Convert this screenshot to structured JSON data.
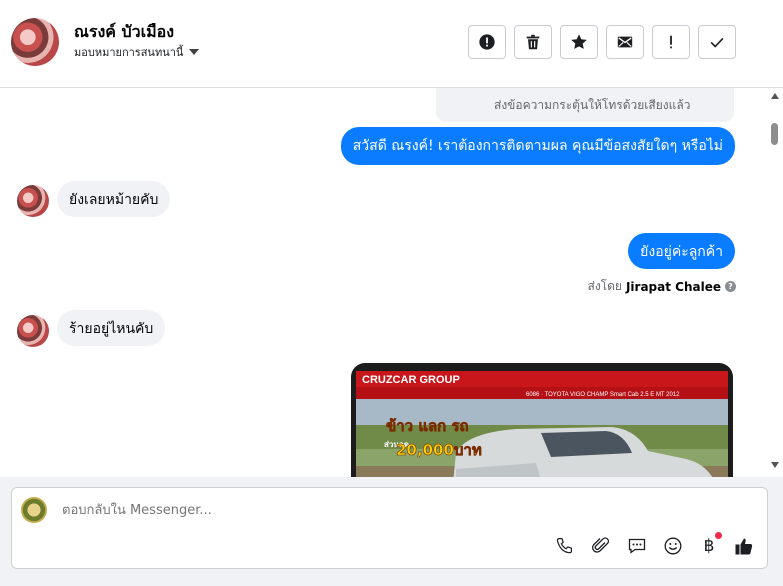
{
  "header": {
    "contact_name": "ณรงค์ บัวเมือง",
    "assign_label": "มอบหมายการสนทนานี้"
  },
  "toolbar": {
    "buttons": [
      {
        "name": "mark-spam-button",
        "icon": "alert-circle-icon"
      },
      {
        "name": "delete-button",
        "icon": "trash-icon"
      },
      {
        "name": "star-button",
        "icon": "star-icon"
      },
      {
        "name": "mark-unread-button",
        "icon": "envelope-icon"
      },
      {
        "name": "follow-up-button",
        "icon": "exclamation-icon"
      },
      {
        "name": "mark-done-button",
        "icon": "check-icon"
      }
    ]
  },
  "messages": {
    "system_note": "ส่งข้อความกระตุ้นให้โทรด้วยเสียงแล้ว",
    "out_1": "สวัสดี ณรงค์! เราต้องการติดตามผล คุณมีข้อสงสัยใดๆ หรือไม่",
    "in_1": "ยังเลยหม้ายคับ",
    "out_2": "ยังอยู่ค่ะลูกค้า",
    "sent_by_prefix": "ส่งโดย",
    "sent_by_name": "Jirapat Chalee",
    "in_2": "ร้ายอยู่ไหนคับ",
    "image_texts": {
      "top_banner": "CRUZCAR GROUP",
      "model": "6086 · TOYOTA VIGO CHAMP Smart Cab 2.5 E MT 2012",
      "promo_line1": "ข้าว แลก รถ",
      "promo_line2": "ส่วนลด",
      "promo_amount": "20,000บาท"
    }
  },
  "composer": {
    "placeholder": "ตอบกลับใน Messenger...",
    "tools": [
      "phone-icon",
      "paperclip-icon",
      "chat-bubble-icon",
      "emoji-icon",
      "baht-icon",
      "like-icon"
    ],
    "baht_symbol": "฿"
  },
  "colors": {
    "accent": "#0a7cff",
    "incoming_bubble": "#f0f2f5",
    "notification_dot": "#f02849"
  }
}
